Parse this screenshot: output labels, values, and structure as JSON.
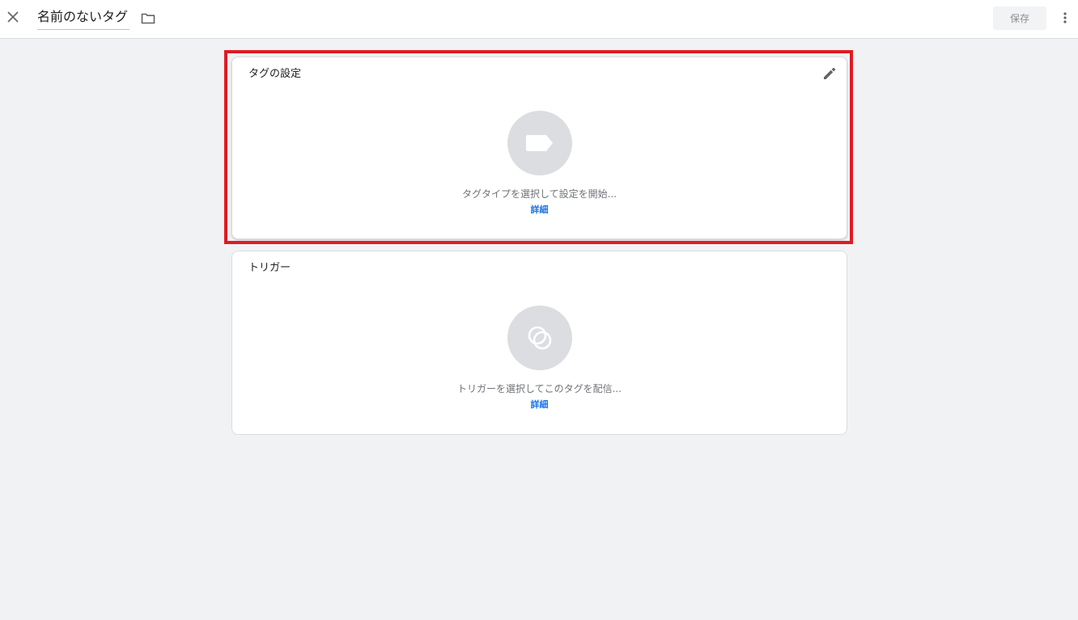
{
  "topbar": {
    "close_icon": "close-icon",
    "title": "名前のないタグ",
    "folder_icon": "folder-icon",
    "save_label": "保存",
    "more_icon": "more-vert-icon"
  },
  "tag_config": {
    "title": "タグの設定",
    "edit_icon": "pencil-icon",
    "placeholder_icon": "tag-icon",
    "hint": "タグタイプを選択して設定を開始...",
    "learn_more": "詳細"
  },
  "trigger": {
    "title": "トリガー",
    "placeholder_icon": "trigger-icon",
    "hint": "トリガーを選択してこのタグを配信...",
    "learn_more": "詳細"
  },
  "colors": {
    "background": "#f1f2f4",
    "highlight": "#e01b24",
    "link": "#1a73e8",
    "placeholder_circle": "#dcdde0"
  }
}
